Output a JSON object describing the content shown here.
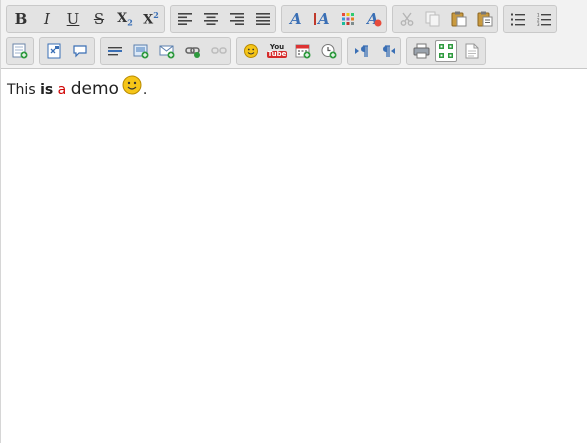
{
  "toolbar": {
    "buttons": {
      "bold": {
        "glyph": "B"
      },
      "italic": {
        "glyph": "I"
      },
      "underline": {
        "glyph": "U"
      },
      "strike": {
        "glyph": "S"
      },
      "subscript": {
        "glyph": "X",
        "mark": "2"
      },
      "superscript": {
        "glyph": "X",
        "mark": "2"
      },
      "youtube_top": "You",
      "youtube_bottom": "Tube"
    },
    "icons": [
      "bold-icon",
      "italic-icon",
      "underline-icon",
      "strikethrough-icon",
      "subscript-icon",
      "superscript-icon",
      "align-left-icon",
      "align-center-icon",
      "align-right-icon",
      "justify-icon",
      "font-name-icon",
      "font-size-icon",
      "font-color-icon",
      "remove-format-icon",
      "cut-icon",
      "copy-icon",
      "paste-icon",
      "paste-text-icon",
      "bullet-list-icon",
      "numbered-list-icon",
      "insert-table-icon",
      "source-icon",
      "quote-icon",
      "horizontal-rule-icon",
      "image-icon",
      "email-icon",
      "link-icon",
      "unlink-icon",
      "emoticon-icon",
      "youtube-icon",
      "date-icon",
      "time-icon",
      "ltr-icon",
      "rtl-icon",
      "print-icon",
      "maximize-icon",
      "source-view-icon"
    ]
  },
  "content": {
    "word_this": "This",
    "word_is": "is",
    "word_a": "a",
    "word_demo": "demo",
    "punct": "."
  },
  "colors": {
    "toolbar_bg": "#f2f2f2",
    "group_bg": "#e3e3e3",
    "red_text": "#d00000",
    "icon_blue": "#3a6fb5"
  }
}
